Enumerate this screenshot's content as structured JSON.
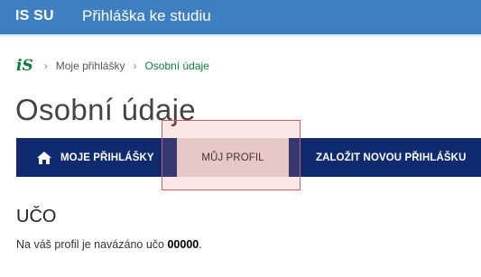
{
  "header": {
    "brand": "IS SU",
    "title": "Přihláška ke studiu"
  },
  "breadcrumb": {
    "logo": "iS",
    "items": [
      "Moje přihlášky",
      "Osobní údaje"
    ]
  },
  "page": {
    "title": "Osobní údaje"
  },
  "nav": {
    "items": [
      {
        "label": "MOJE PŘIHLÁŠKY",
        "icon": "home-icon"
      },
      {
        "label": "MŮJ PROFIL"
      },
      {
        "label": "ZALOŽIT NOVOU PŘIHLÁŠKU"
      }
    ]
  },
  "uco": {
    "heading": "UČO",
    "text_before": "Na váš profil je navázáno učo ",
    "value": "00000",
    "text_after": "."
  },
  "colors": {
    "header_bg": "#3d7fc1",
    "nav_bg": "#0f2a6e",
    "accent_green": "#0d7a3b",
    "highlight_border": "#d06060"
  }
}
